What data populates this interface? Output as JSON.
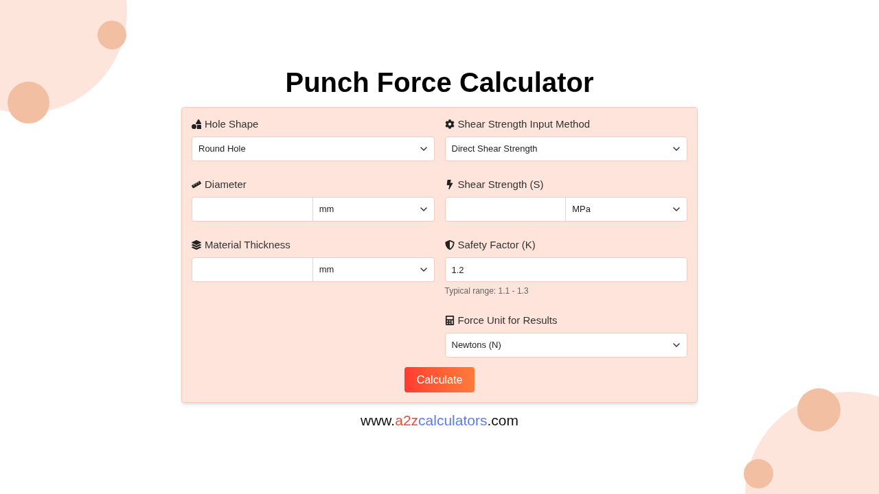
{
  "title": "Punch Force Calculator",
  "columns": [
    [
      {
        "kind": "select",
        "label": "Hole Shape",
        "value": "Round Hole"
      },
      {
        "kind": "value_unit",
        "label": "Diameter",
        "unit": "mm"
      },
      {
        "kind": "value_unit",
        "label": "Material Thickness",
        "unit": "mm"
      }
    ],
    [
      {
        "kind": "select",
        "label": "Shear Strength Input Method",
        "value": "Direct Shear Strength"
      },
      {
        "kind": "value_unit",
        "label": "Shear Strength (S)",
        "unit": "MPa"
      },
      {
        "kind": "input",
        "label": "Safety Factor (K)",
        "value": "1.2",
        "hint": "Typical range: 1.1 - 1.3"
      },
      {
        "kind": "select",
        "label": "Force Unit for Results",
        "value": "Newtons (N)"
      }
    ]
  ],
  "button": "Calculate",
  "footer": [
    {
      "text": "www.",
      "color": "#111111"
    },
    {
      "text": "a2z",
      "color": "#f0483e"
    },
    {
      "text": "calculators",
      "color": "#5b7cf0"
    },
    {
      "text": ".com",
      "color": "#111111"
    }
  ]
}
